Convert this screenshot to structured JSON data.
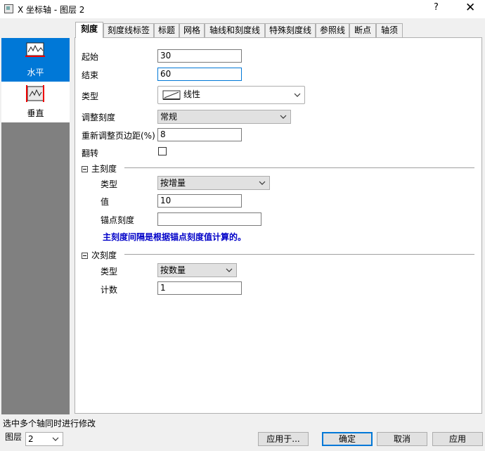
{
  "window": {
    "title": "X 坐标轴 - 图层 2",
    "help_label": "?",
    "close_label": "✕",
    "app_icon": "app-icon"
  },
  "sidebar": {
    "items": [
      {
        "label": "水平",
        "icon": "horizontal-axis-icon",
        "selected": true
      },
      {
        "label": "垂直",
        "icon": "vertical-axis-icon",
        "selected": false
      }
    ]
  },
  "tabs": [
    {
      "label": "刻度",
      "active": true
    },
    {
      "label": "刻度线标签"
    },
    {
      "label": "标题"
    },
    {
      "label": "网格"
    },
    {
      "label": "轴线和刻度线"
    },
    {
      "label": "特殊刻度线"
    },
    {
      "label": "参照线"
    },
    {
      "label": "断点"
    },
    {
      "label": "轴须"
    }
  ],
  "scale": {
    "start_label": "起始",
    "start_value": "30",
    "end_label": "结束",
    "end_value": "60",
    "type_label": "类型",
    "type_value": "线性",
    "rescale_label": "调整刻度",
    "rescale_value": "常规",
    "margin_label": "重新调整页边距(%)",
    "margin_value": "8",
    "reverse_label": "翻转",
    "reverse_checked": false
  },
  "major_ticks": {
    "header": "主刻度",
    "type_label": "类型",
    "type_value": "按增量",
    "value_label": "值",
    "value_value": "10",
    "anchor_label": "锚点刻度",
    "anchor_value": "",
    "note": "主刻度间隔是根据锚点刻度值计算的。"
  },
  "minor_ticks": {
    "header": "次刻度",
    "type_label": "类型",
    "type_value": "按数量",
    "count_label": "计数",
    "count_value": "1"
  },
  "footer": {
    "status": "选中多个轴同时进行修改",
    "layer_label": "图层",
    "layer_value": "2",
    "apply_to": "应用于...",
    "ok": "确定",
    "cancel": "取消",
    "apply": "应用"
  },
  "colors": {
    "accent": "#0078d7",
    "note_text": "#0000c8",
    "sidebar_bg": "#808080"
  }
}
